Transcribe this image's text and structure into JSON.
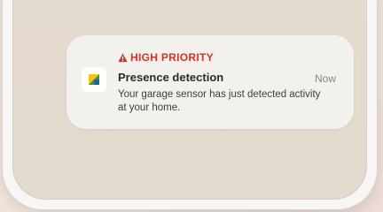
{
  "notification": {
    "priority_label": "HIGH PRIORITY",
    "title": "Presence detection",
    "time": "Now",
    "body": "Your garage sensor has just detected activity at your home.",
    "priority_color": "#d93025",
    "icons": {
      "priority": "warning-icon",
      "app": "app-icon"
    }
  }
}
